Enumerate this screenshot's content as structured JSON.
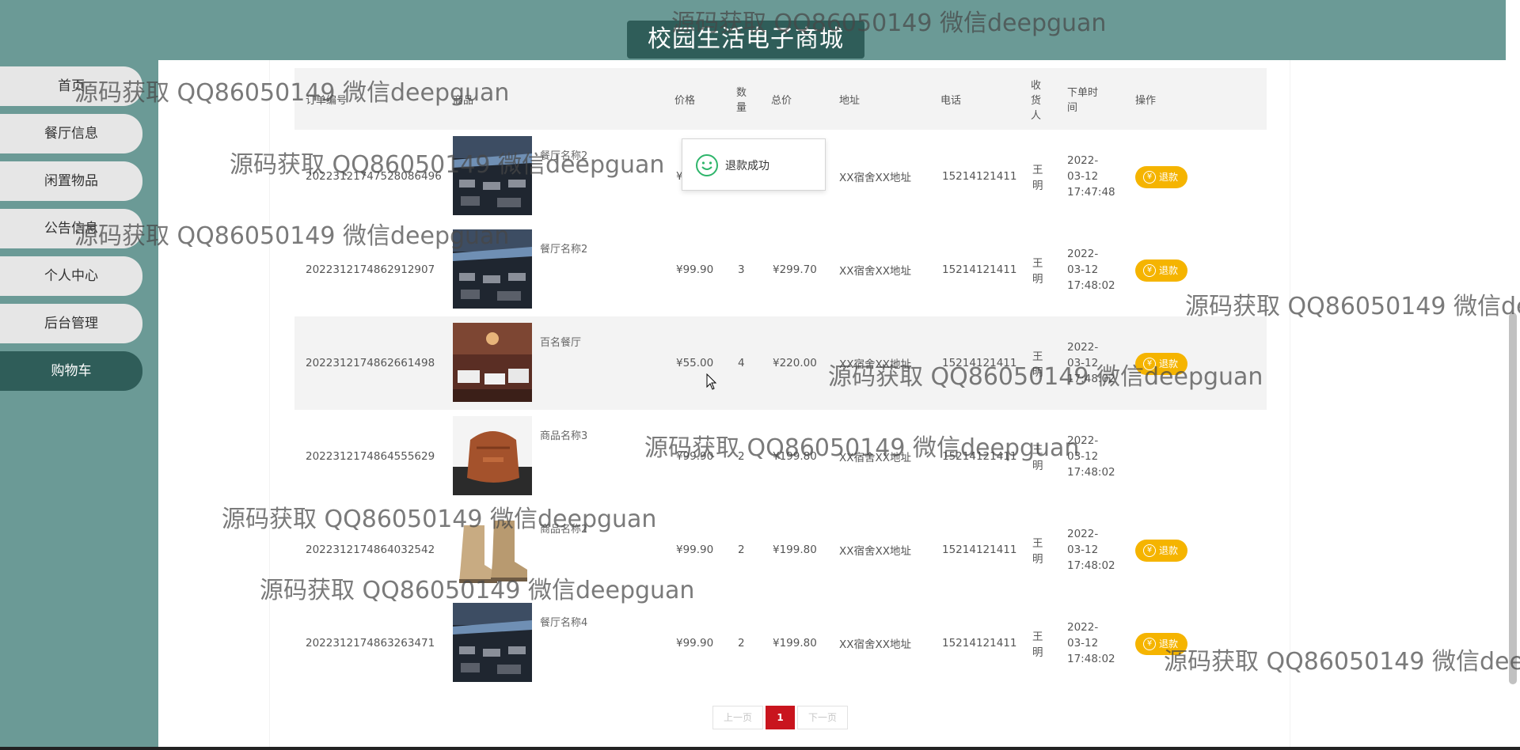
{
  "header": {
    "title": "校园生活电子商城"
  },
  "nav": [
    {
      "label": "首页",
      "active": false
    },
    {
      "label": "餐厅信息",
      "active": false
    },
    {
      "label": "闲置物品",
      "active": false
    },
    {
      "label": "公告信息",
      "active": false
    },
    {
      "label": "个人中心",
      "active": false
    },
    {
      "label": "后台管理",
      "active": false
    },
    {
      "label": "购物车",
      "active": true
    }
  ],
  "table": {
    "columns": [
      "订单编号",
      "商品",
      "价格",
      "数量",
      "总价",
      "地址",
      "电话",
      "收货人",
      "下单时间",
      "操作"
    ],
    "rows": [
      {
        "order_no": "20223121747528086496",
        "product": "餐厅名称2",
        "thumb": "restaurant-dark-icon",
        "price": "¥",
        "qty": "",
        "total": "",
        "address": "XX宿舍XX地址",
        "phone": "15214121411",
        "receiver": "王明",
        "time": [
          "2022-",
          "03-12",
          "17:47:48"
        ],
        "action": "退款"
      },
      {
        "order_no": "2022312174862912907",
        "product": "餐厅名称2",
        "thumb": "restaurant-dark-icon",
        "price": "¥99.90",
        "qty": "3",
        "total": "¥299.70",
        "address": "XX宿舍XX地址",
        "phone": "15214121411",
        "receiver": "王明",
        "time": [
          "2022-",
          "03-12",
          "17:48:02"
        ],
        "action": "退款"
      },
      {
        "order_no": "2022312174862661498",
        "product": "百名餐厅",
        "thumb": "restaurant-red-icon",
        "price": "¥55.00",
        "qty": "4",
        "total": "¥220.00",
        "address": "XX宿舍XX地址",
        "phone": "15214121411",
        "receiver": "王明",
        "time": [
          "2022-",
          "03-12",
          "17:48:02"
        ],
        "action": "退款"
      },
      {
        "order_no": "2022312174864555629",
        "product": "商品名称3",
        "thumb": "bag-icon",
        "price": "¥99.90",
        "qty": "2",
        "total": "¥199.80",
        "address": "XX宿舍XX地址",
        "phone": "15214121411",
        "receiver": "王明",
        "time": [
          "2022-",
          "03-12",
          "17:48:02"
        ],
        "action": ""
      },
      {
        "order_no": "2022312174864032542",
        "product": "商品名称2",
        "thumb": "boots-icon",
        "price": "¥99.90",
        "qty": "2",
        "total": "¥199.80",
        "address": "XX宿舍XX地址",
        "phone": "15214121411",
        "receiver": "王明",
        "time": [
          "2022-",
          "03-12",
          "17:48:02"
        ],
        "action": "退款"
      },
      {
        "order_no": "2022312174863263471",
        "product": "餐厅名称4",
        "thumb": "restaurant-dark-icon",
        "price": "¥99.90",
        "qty": "2",
        "total": "¥199.80",
        "address": "XX宿舍XX地址",
        "phone": "15214121411",
        "receiver": "王明",
        "time": [
          "2022-",
          "03-12",
          "17:48:02"
        ],
        "action": "退款"
      }
    ]
  },
  "toast": {
    "message": "退款成功",
    "icon": "smile-icon"
  },
  "pagination": {
    "prev": "上一页",
    "current": "1",
    "next": "下一页"
  },
  "watermark": "源码获取 QQ86050149 微信deepguan",
  "colors": {
    "teal": "#6b9a96",
    "dark_teal": "#2f5d59",
    "refund": "#f5b400",
    "page_current": "#c9151e"
  }
}
